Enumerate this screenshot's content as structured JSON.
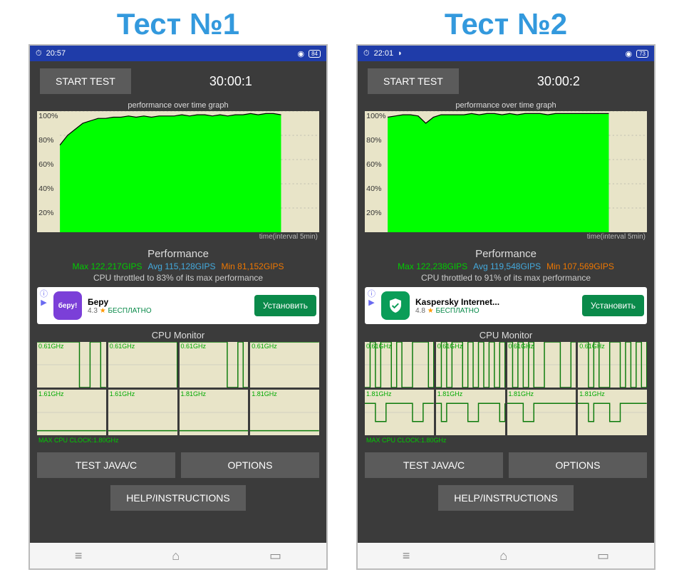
{
  "tests": [
    {
      "title": "Тест №1",
      "statusbar": {
        "time": "20:57",
        "battery": "84"
      },
      "startBtn": "START TEST",
      "timer": "30:00:1",
      "graphTitle": "performance over time graph",
      "xLabel": "time(interval 5min)",
      "perfHeader": "Performance",
      "stats": {
        "max": "Max 122,217GIPS",
        "avg": "Avg 115,128GIPS",
        "min": "Min 81,152GIPS"
      },
      "throttle": "CPU throttled to 83% of its max performance",
      "ad": {
        "iconBg": "#7b3fd8",
        "iconText": "беру!",
        "name": "Беру",
        "rating": "4.3",
        "price": "БЕСПЛАТНО",
        "cta": "Установить"
      },
      "cpuTitle": "CPU Monitor",
      "coreLabel1": "0.61GHz",
      "coreLabel2": "1.61GHz",
      "coreLabel2b": "1.81GHz",
      "maxClock": "MAX CPU CLOCK:1.80GHz",
      "btnJava": "TEST JAVA/C",
      "btnOpts": "OPTIONS",
      "btnHelp": "HELP/INSTRUCTIONS",
      "perfProfile": [
        72,
        80,
        85,
        90,
        92,
        94,
        94,
        95,
        95,
        96,
        95,
        96,
        95,
        96,
        96,
        96,
        97,
        96,
        97,
        97,
        96,
        97,
        96,
        97,
        97,
        98,
        97,
        98,
        98,
        97
      ],
      "coreTop": [
        [
          100,
          100,
          100,
          100,
          100,
          100,
          100,
          100,
          0,
          0,
          100,
          100,
          0,
          0
        ],
        [
          100,
          100,
          100,
          100,
          100,
          100,
          100,
          100,
          100,
          100,
          100,
          100,
          100,
          0
        ],
        [
          100,
          100,
          100,
          100,
          100,
          100,
          100,
          100,
          100,
          0,
          0,
          100,
          0,
          0
        ],
        [
          100,
          100,
          100,
          100,
          100,
          100,
          100,
          100,
          100,
          100,
          100,
          100,
          100,
          100
        ]
      ],
      "coreBot": [
        [
          10,
          10,
          10,
          10,
          10,
          10,
          10,
          10,
          10,
          10,
          10,
          10,
          10,
          10
        ],
        [
          10,
          10,
          10,
          10,
          10,
          10,
          10,
          10,
          10,
          10,
          10,
          10,
          10,
          10
        ],
        [
          10,
          10,
          10,
          10,
          10,
          10,
          10,
          10,
          10,
          10,
          10,
          10,
          10,
          10
        ],
        [
          10,
          10,
          10,
          10,
          10,
          10,
          10,
          10,
          10,
          10,
          10,
          10,
          10,
          10
        ]
      ]
    },
    {
      "title": "Тест №2",
      "statusbar": {
        "time": "22:01",
        "battery": "73"
      },
      "startBtn": "START TEST",
      "timer": "30:00:2",
      "graphTitle": "performance over time graph",
      "xLabel": "time(interval 5min)",
      "perfHeader": "Performance",
      "stats": {
        "max": "Max 122,238GIPS",
        "avg": "Avg 119,548GIPS",
        "min": "Min 107,569GIPS"
      },
      "throttle": "CPU throttled to 91% of its max performance",
      "ad": {
        "iconBg": "#0a9d58",
        "iconText": "",
        "name": "Kaspersky Internet...",
        "rating": "4.8",
        "price": "БЕСПЛАТНО",
        "cta": "Установить"
      },
      "cpuTitle": "CPU Monitor",
      "coreLabel1": "0.61GHz",
      "coreLabel2": "1.81GHz",
      "coreLabel2b": "1.81GHz",
      "maxClock": "MAX CPU CLOCK:1.80GHz",
      "btnJava": "TEST JAVA/C",
      "btnOpts": "OPTIONS",
      "btnHelp": "HELP/INSTRUCTIONS",
      "perfProfile": [
        95,
        96,
        97,
        97,
        96,
        90,
        95,
        97,
        97,
        97,
        97,
        98,
        97,
        98,
        98,
        97,
        98,
        97,
        98,
        98,
        98,
        97,
        98,
        98,
        98,
        98,
        98,
        98,
        98,
        98
      ],
      "coreTop": [
        [
          0,
          100,
          0,
          100,
          100,
          0,
          100,
          0,
          0,
          100,
          100,
          100,
          0,
          100
        ],
        [
          0,
          100,
          0,
          100,
          100,
          0,
          100,
          0,
          100,
          0,
          100,
          0,
          100,
          0
        ],
        [
          100,
          0,
          100,
          0,
          100,
          0,
          0,
          100,
          100,
          100,
          0,
          0,
          100,
          0
        ],
        [
          100,
          100,
          0,
          100,
          0,
          0,
          100,
          100,
          0,
          100,
          0,
          100,
          0,
          100
        ]
      ],
      "coreBot": [
        [
          70,
          70,
          30,
          30,
          70,
          70,
          70,
          70,
          70,
          30,
          30,
          70,
          70,
          70
        ],
        [
          70,
          30,
          70,
          70,
          70,
          70,
          30,
          30,
          70,
          70,
          70,
          70,
          30,
          70
        ],
        [
          70,
          70,
          70,
          30,
          30,
          70,
          70,
          70,
          70,
          70,
          70,
          70,
          70,
          70
        ],
        [
          70,
          70,
          30,
          70,
          70,
          70,
          30,
          30,
          70,
          70,
          70,
          70,
          70,
          70
        ]
      ]
    }
  ],
  "yticks": [
    "100%",
    "80%",
    "60%",
    "40%",
    "20%"
  ],
  "chart_data": [
    {
      "type": "area",
      "title": "performance over time graph (Test 1)",
      "xlabel": "time(interval 5min)",
      "ylabel": "%",
      "ylim": [
        0,
        100
      ],
      "values": [
        72,
        80,
        85,
        90,
        92,
        94,
        94,
        95,
        95,
        96,
        95,
        96,
        95,
        96,
        96,
        96,
        97,
        96,
        97,
        97,
        96,
        97,
        96,
        97,
        97,
        98,
        97,
        98,
        98,
        97
      ]
    },
    {
      "type": "area",
      "title": "performance over time graph (Test 2)",
      "xlabel": "time(interval 5min)",
      "ylabel": "%",
      "ylim": [
        0,
        100
      ],
      "values": [
        95,
        96,
        97,
        97,
        96,
        90,
        95,
        97,
        97,
        97,
        97,
        98,
        97,
        98,
        98,
        97,
        98,
        97,
        98,
        98,
        98,
        97,
        98,
        98,
        98,
        98,
        98,
        98,
        98,
        98
      ]
    }
  ]
}
